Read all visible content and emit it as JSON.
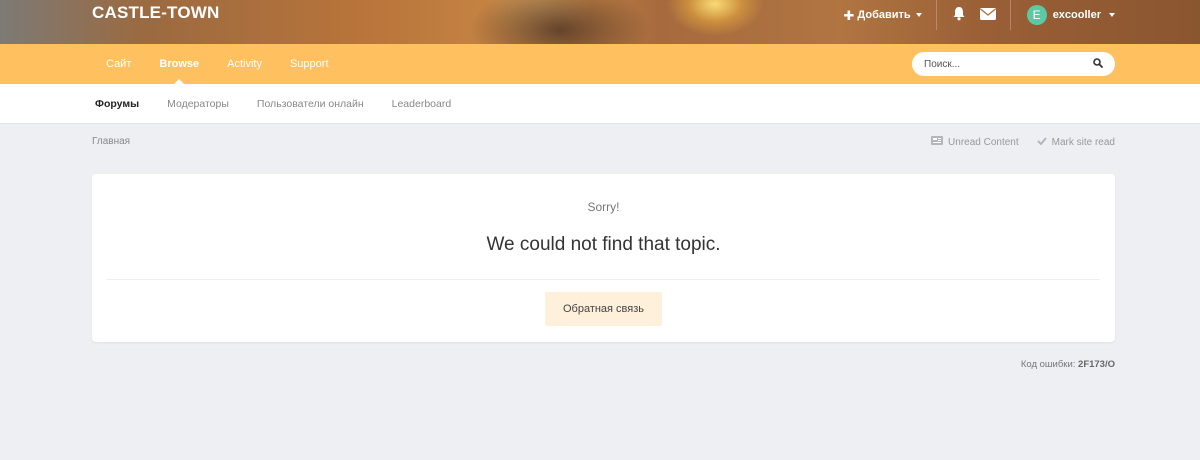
{
  "header": {
    "logo": "CASTLE-TOWN",
    "add_label": "Добавить",
    "username": "excooller",
    "avatar_letter": "E"
  },
  "nav_primary": {
    "items": [
      {
        "label": "Сайт"
      },
      {
        "label": "Browse",
        "active": true
      },
      {
        "label": "Activity"
      },
      {
        "label": "Support"
      }
    ]
  },
  "search": {
    "placeholder": "Поиск...",
    "icon": "search-icon"
  },
  "nav_secondary": {
    "items": [
      {
        "label": "Форумы",
        "active": true
      },
      {
        "label": "Модераторы"
      },
      {
        "label": "Пользователи онлайн"
      },
      {
        "label": "Leaderboard"
      }
    ]
  },
  "breadcrumb": {
    "home": "Главная",
    "unread": "Unread Content",
    "mark_read": "Mark site read"
  },
  "error": {
    "sorry": "Sorry!",
    "message": "We could not find that topic.",
    "feedback_button": "Обратная связь",
    "code_label": "Код ошибки:",
    "code": "2F173/O"
  },
  "colors": {
    "nav_bar": "#ffc160",
    "avatar": "#5cc9a5",
    "feedback_button_bg": "#fff0dc"
  }
}
